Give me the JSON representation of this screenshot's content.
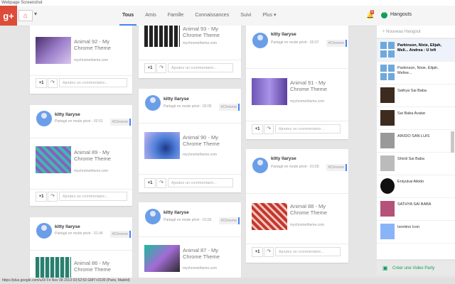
{
  "window_title": "Webpage Screenshot",
  "header": {
    "logo": "g+",
    "tabs": [
      "Tous",
      "Amis",
      "Famille",
      "Connaissances",
      "Suivi",
      "Plus"
    ],
    "notif_count": "9"
  },
  "hangouts": {
    "title": "Hangouts",
    "new_placeholder": "+ Nouveau Hangout",
    "items": [
      {
        "name": "Parkinson, Nixie, Elijah, Meli... Andrea : U left"
      },
      {
        "name": "Parkinson, Nixie, Elijah, Melise..."
      },
      {
        "name": "Sathya Sai Baba"
      },
      {
        "name": "Sai Baba Avatar"
      },
      {
        "name": "AIKIDO SAN LUIS"
      },
      {
        "name": "Shirdi Sai Baba"
      },
      {
        "name": "Entyukai Aikido"
      },
      {
        "name": "SATHYA SAI BABA"
      },
      {
        "name": "Isontino Icon"
      }
    ],
    "video_party": "Créer une Video Party"
  },
  "cards": {
    "c1": {
      "title": "Animal 92 - My Chrome Theme",
      "url": "mychrometheme.com",
      "comment": "Ajoutez un commentaire..."
    },
    "c2": {
      "name": "kitty llaryse",
      "meta": "Partagé en mode privé - 02:01",
      "tag": "#Chrome",
      "title": "Animal 89 - My Chrome Theme",
      "url": "mychrometheme.com",
      "comment": "Ajoutez un commentaire..."
    },
    "c3": {
      "name": "kitty llaryse",
      "meta": "Partagé en mode privé - 01:34",
      "tag": "#Chrome",
      "title": "Animal 86 - My Chrome Theme"
    },
    "c4": {
      "title": "Animal 93 - My Chrome Theme",
      "url": "mychrometheme.com",
      "comment": "Ajoutez un commentaire..."
    },
    "c5": {
      "name": "kitty llaryse",
      "meta": "Partagé en mode privé - 02:05",
      "tag": "#Chrome",
      "title": "Animal 90 - My Chrome Theme",
      "url": "mychrometheme.com",
      "comment": "Ajoutez un commentaire..."
    },
    "c6": {
      "name": "kitty llaryse",
      "meta": "Partagé en mode privé - 01:56",
      "tag": "#Chrome",
      "title": "Animal 87 - My Chrome Theme",
      "url": "mychrometheme.com"
    },
    "c7": {
      "name": "kitty llaryse",
      "meta": "Partagé en mode privé - 02:07",
      "tag": "#Chrome",
      "title": "Animal 91 - My Chrome Theme",
      "url": "mychrometheme.com",
      "comment": "Ajoutez un commentaire..."
    },
    "c8": {
      "name": "kitty llaryse",
      "meta": "Partagé en mode privé - 01:59",
      "tag": "#Chrome",
      "title": "Animal 88 - My Chrome Theme",
      "url": "mychrometheme.com",
      "comment": "Ajoutez un commentaire..."
    }
  },
  "plus1": "+1",
  "status_url": "https://plus.google.com/u/0/ Fri Nov 08 2013 03:52:53 GMT+0100 (Paris, Madrid)"
}
